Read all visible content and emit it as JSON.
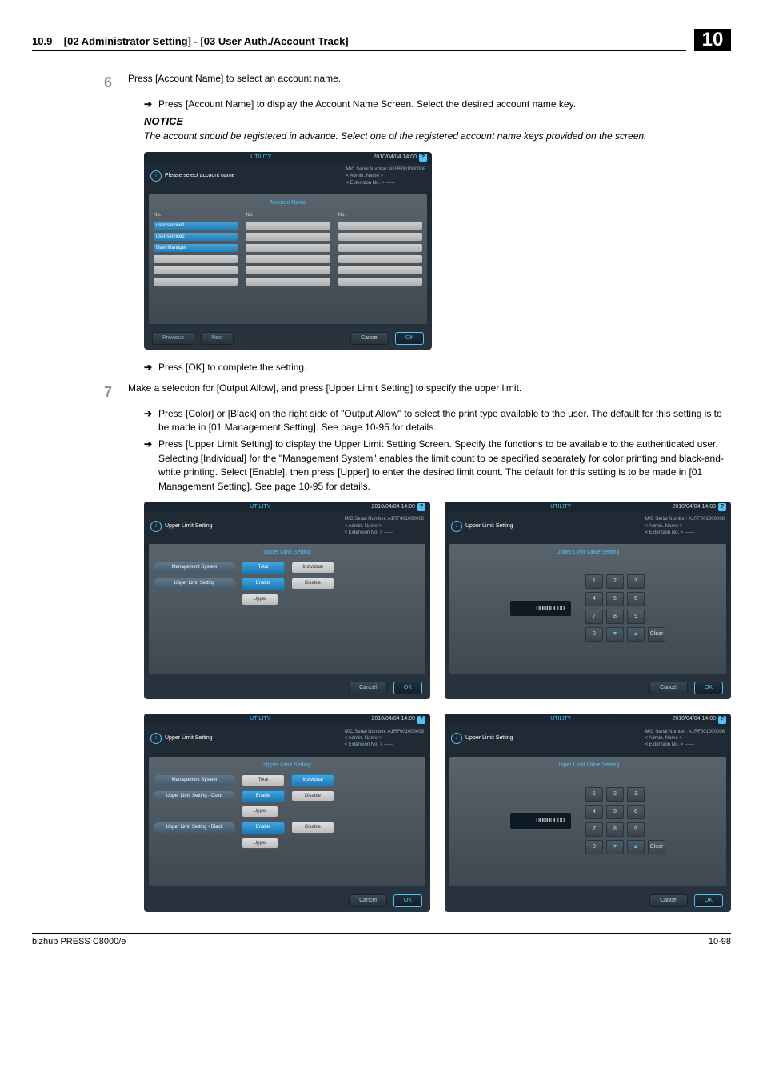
{
  "header": {
    "section_num": "10.9",
    "breadcrumb": "[02 Administrator Setting] - [03 User Auth./Account Track]",
    "chapter": "10"
  },
  "step6": {
    "num": "6",
    "text": "Press [Account Name] to select an account name.",
    "bullet1": "Press [Account Name] to display the Account Name Screen. Select the desired account name key.",
    "notice_title": "NOTICE",
    "notice_body": "The account should be registered in advance. Select one of the registered account name keys provided on the screen.",
    "bullet2": "Press [OK] to complete the setting."
  },
  "step7": {
    "num": "7",
    "text": "Make a selection for [Output Allow], and press [Upper Limit Setting] to specify the upper limit.",
    "bullet1": "Press [Color] or [Black] on the right side of \"Output Allow\" to select the print type available to the user. The default for this setting is to be made in [01 Management Setting]. See page 10-95 for details.",
    "bullet2": "Press [Upper Limit Setting] to display the Upper Limit Setting Screen. Specify the functions to be available to the authenticated user. Selecting [Individual] for the \"Management System\" enables the limit count to be specified separately for color printing and black-and-white printing. Select [Enable], then press [Upper] to enter the desired limit count. The default for this setting is to be made in [01 Management Setting]. See page 10-95 for details."
  },
  "shot_common": {
    "utility": "UTILITY",
    "timestamp": "2010/04/04 14:00",
    "help": "?",
    "serial_label": "M/C Serial Number:",
    "serial_value": "A1RF001000008",
    "admin_label": "< Admin. Name >",
    "ext_label": "< Extension No. > ------",
    "info_i": "i",
    "cancel": "Cancel",
    "ok": "OK",
    "prev": "Previous",
    "next": "Next"
  },
  "shot1": {
    "prompt": "Please select account name",
    "panel_title": "Account Name",
    "col_label": "No.",
    "acct1": "user service1",
    "acct2": "user service2",
    "acct3": "User Manager"
  },
  "shot2": {
    "title": "Upper Limit Setting",
    "panel_title": "Upper Limit Setting",
    "row1_label": "Management System",
    "row1_opt1": "Total",
    "row1_opt2": "Individual",
    "row2_label": "Upper Limit Setting",
    "enable": "Enable",
    "disable": "Disable",
    "upper": "Upper"
  },
  "shot3": {
    "title": "Upper Limit Setting",
    "panel_title": "Upper Limit Value Setting",
    "value": "00000000",
    "k1": "1",
    "k2": "2",
    "k3": "3",
    "k4": "4",
    "k5": "5",
    "k6": "6",
    "k7": "7",
    "k8": "8",
    "k9": "9",
    "k0": "0",
    "kdn": "▼",
    "kup": "▲",
    "clear": "Clear"
  },
  "shot4": {
    "title": "Upper Limit Setting",
    "panel_title": "Upper Limit Setting",
    "row1_label": "Management System",
    "total": "Total",
    "individual": "Individual",
    "row2_label": "Upper Limit Setting - Color",
    "row3_label": "Upper Limit Setting - Black",
    "enable": "Enable",
    "disable": "Disable",
    "upper": "Upper"
  },
  "footer": {
    "product": "bizhub PRESS C8000/e",
    "page": "10-98"
  }
}
